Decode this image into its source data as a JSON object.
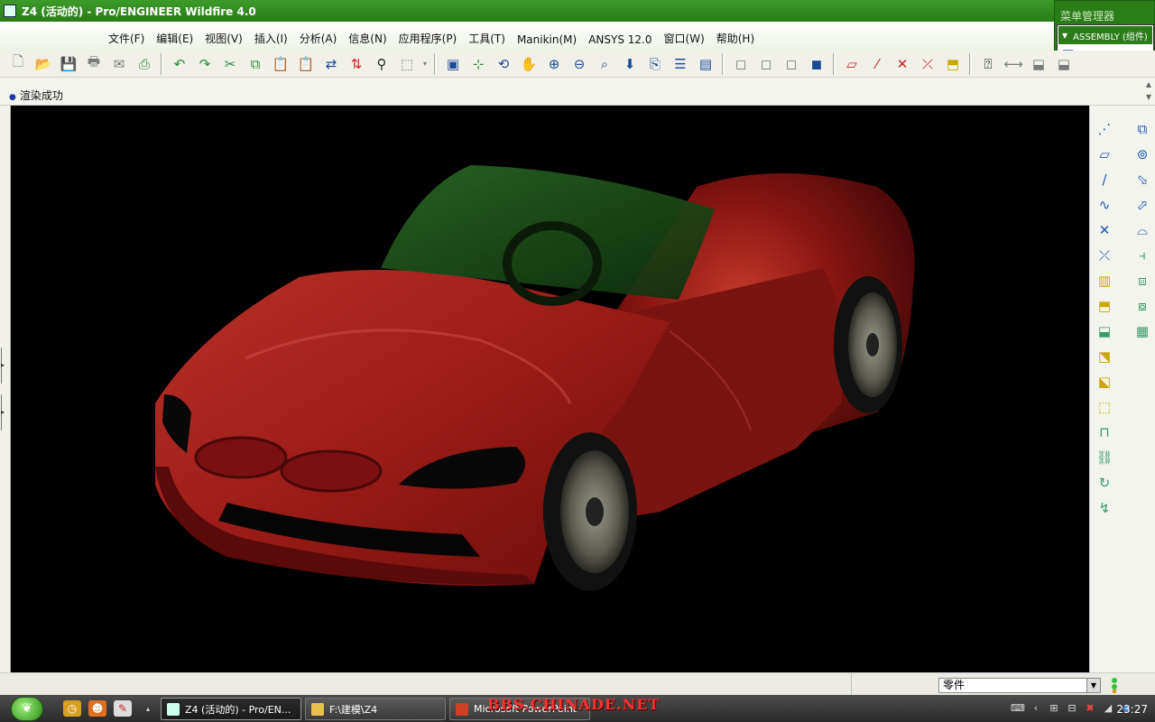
{
  "window": {
    "title": "Z4 (活动的) - Pro/ENGINEER Wildfire 4.0"
  },
  "menu_manager": {
    "title": "菜单管理器",
    "item": "ASSEMBLY (组件)"
  },
  "menubar": {
    "items": [
      "文件(F)",
      "编辑(E)",
      "视图(V)",
      "插入(I)",
      "分析(A)",
      "信息(N)",
      "应用程序(P)",
      "工具(T)",
      "Manikin(M)",
      "ANSYS 12.0",
      "窗口(W)",
      "帮助(H)"
    ]
  },
  "message_area": {
    "message": "渲染成功"
  },
  "status_bar": {
    "selection_filter": "零件"
  },
  "taskbar": {
    "tasks": [
      {
        "label": "Z4 (活动的) - Pro/EN..."
      },
      {
        "label": "F:\\建模\\Z4"
      },
      {
        "label": "Microsoft PowerPoint"
      }
    ],
    "watermark": "BBS.CHINADE.NET",
    "clock": "23:27"
  },
  "colors": {
    "title_green": "#2a7d18",
    "car_body": "#8a1010",
    "windshield": "#1f5a1a"
  }
}
